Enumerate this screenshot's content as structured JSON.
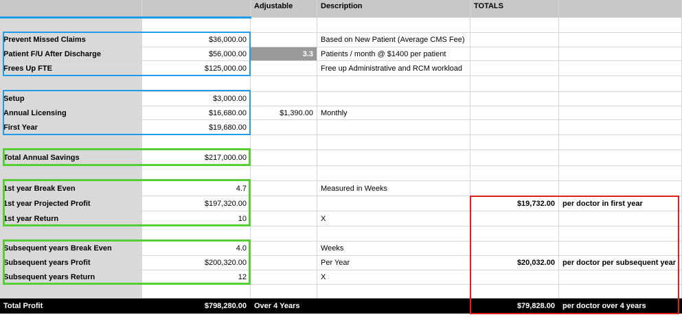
{
  "headers": {
    "col0": "",
    "col1": "",
    "col2": "Adjustable",
    "col3": "Description",
    "col4": "TOTALS"
  },
  "rows": [
    {
      "label": "",
      "value": "",
      "adjustable": "",
      "description": "",
      "total": "",
      "total_desc": ""
    },
    {
      "label": "Prevent Missed Claims",
      "value": "$36,000.00",
      "adjustable": "",
      "description": "Based on New Patient (Average CMS Fee)",
      "total": "",
      "total_desc": ""
    },
    {
      "label": "Patient F/U After Discharge",
      "value": "$56,000.00",
      "adjustable": "3.3",
      "description": "Patients / month @ $1400 per patient",
      "total": "",
      "total_desc": ""
    },
    {
      "label": "Frees Up FTE",
      "value": "$125,000.00",
      "adjustable": "",
      "description": "Free up Administrative and RCM workload",
      "total": "",
      "total_desc": ""
    },
    {
      "label": "",
      "value": "",
      "adjustable": "",
      "description": "",
      "total": "",
      "total_desc": ""
    },
    {
      "label": "Setup",
      "value": "$3,000.00",
      "adjustable": "",
      "description": "",
      "total": "",
      "total_desc": ""
    },
    {
      "label": "Annual Licensing",
      "value": "$16,680.00",
      "adjustable": "$1,390.00",
      "description": "Monthly",
      "total": "",
      "total_desc": ""
    },
    {
      "label": "First Year",
      "value": "$19,680.00",
      "adjustable": "",
      "description": "",
      "total": "",
      "total_desc": ""
    },
    {
      "label": "",
      "value": "",
      "adjustable": "",
      "description": "",
      "total": "",
      "total_desc": ""
    },
    {
      "label": "Total Annual Savings",
      "value": "$217,000.00",
      "adjustable": "",
      "description": "",
      "total": "",
      "total_desc": ""
    },
    {
      "label": "",
      "value": "",
      "adjustable": "",
      "description": "",
      "total": "",
      "total_desc": ""
    },
    {
      "label": "1st year Break Even",
      "value": "4.7",
      "adjustable": "",
      "description": "Measured in Weeks",
      "total": "",
      "total_desc": ""
    },
    {
      "label": "1st year Projected Profit",
      "value": "$197,320.00",
      "adjustable": "",
      "description": "",
      "total": "$19,732.00",
      "total_desc": "per doctor in first year"
    },
    {
      "label": "1st year Return",
      "value": "10",
      "adjustable": "",
      "description": "X",
      "total": "",
      "total_desc": ""
    },
    {
      "label": "",
      "value": "",
      "adjustable": "",
      "description": "",
      "total": "",
      "total_desc": ""
    },
    {
      "label": "Subsequent years Break Even",
      "value": "4.0",
      "adjustable": "",
      "description": "Weeks",
      "total": "",
      "total_desc": ""
    },
    {
      "label": "Subsequent years Profit",
      "value": "$200,320.00",
      "adjustable": "",
      "description": "Per Year",
      "total": "$20,032.00",
      "total_desc": "per doctor per subsequent year"
    },
    {
      "label": "Subsequent years Return",
      "value": "12",
      "adjustable": "",
      "description": "X",
      "total": "",
      "total_desc": ""
    },
    {
      "label": "",
      "value": "",
      "adjustable": "",
      "description": "",
      "total": "",
      "total_desc": ""
    },
    {
      "label": "Total Profit",
      "value": "$798,280.00",
      "adjustable": "Over 4 Years",
      "description": "",
      "total": "$79,828.00",
      "total_desc": "per doctor over 4 years"
    }
  ],
  "colors": {
    "blue_box": "#1e9be9",
    "green_box": "#56cf35",
    "red_box": "#e0201c",
    "header_bg": "#c8c8c8",
    "label_bg": "#d9d9d9"
  }
}
